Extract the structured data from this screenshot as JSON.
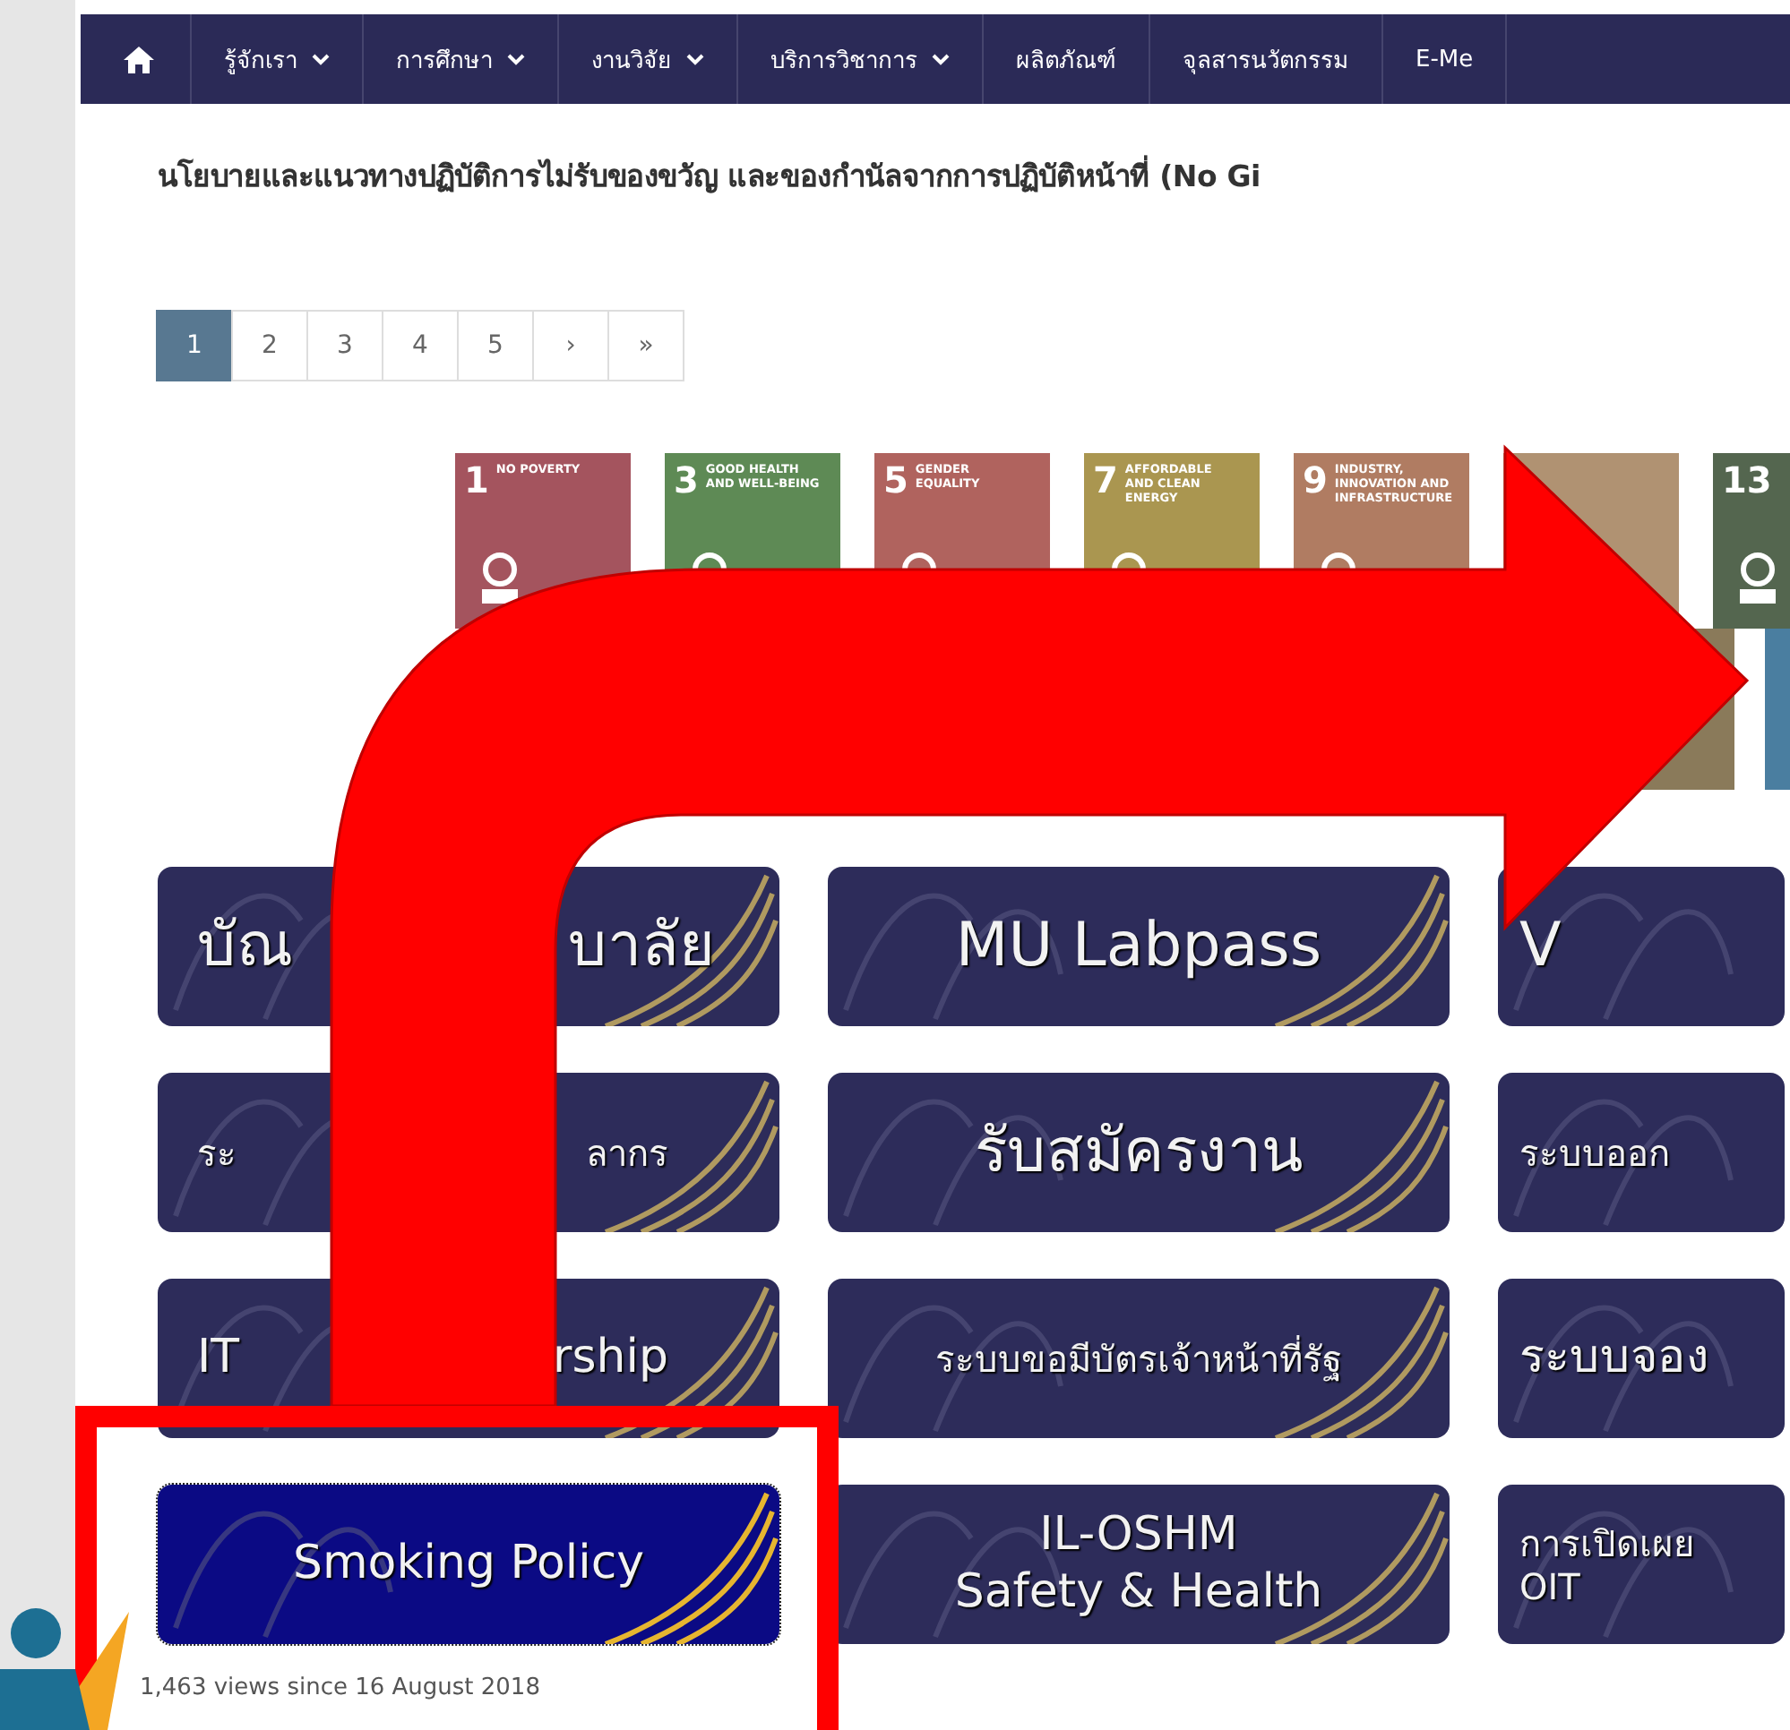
{
  "nav": {
    "items": [
      {
        "kind": "home"
      },
      {
        "kind": "text",
        "label": "รู้จักเรา",
        "has_menu": true
      },
      {
        "kind": "text",
        "label": "การศึกษา",
        "has_menu": true
      },
      {
        "kind": "text",
        "label": "งานวิจัย",
        "has_menu": true
      },
      {
        "kind": "text",
        "label": "บริการวิชาการ",
        "has_menu": true
      },
      {
        "kind": "text",
        "label": "ผลิตภัณฑ์",
        "has_menu": false
      },
      {
        "kind": "text",
        "label": "จุลสารนวัตกรรม",
        "has_menu": false
      },
      {
        "kind": "text",
        "label": "E-Me",
        "has_menu": false
      }
    ]
  },
  "heading": "นโยบายและแนวทางปฏิบัติการไม่รับของขวัญ และของกำนัลจากการปฏิบัติหน้าที่ (No Gi",
  "pagination": [
    {
      "label": "1",
      "selected": true
    },
    {
      "label": "2",
      "selected": false
    },
    {
      "label": "3",
      "selected": false
    },
    {
      "label": "4",
      "selected": false
    },
    {
      "label": "5",
      "selected": false
    },
    {
      "label": "›",
      "selected": false
    },
    {
      "label": "»",
      "selected": false
    }
  ],
  "goal_tiles": [
    [
      {
        "number": "1",
        "title": "NO POVERTY",
        "color": "#a4545e"
      },
      {
        "number": "3",
        "title": "GOOD HEALTH AND WELL-BEING",
        "color": "#5e8a55"
      },
      {
        "number": "5",
        "title": "GENDER EQUALITY",
        "color": "#b0635e"
      },
      {
        "number": "7",
        "title": "AFFORDABLE AND CLEAN ENERGY",
        "color": "#aa9650"
      },
      {
        "number": "9",
        "title": "INDUSTRY, INNOVATION AND INFRASTRUCTURE",
        "color": "#b07c62"
      },
      {
        "color": "#b09272"
      },
      {
        "number": "13",
        "color": "#54664f"
      }
    ],
    [
      {
        "color": "#8a7a5a"
      },
      {
        "color": "#4a7ea0"
      }
    ]
  ],
  "link_buttons": [
    {
      "kind": "large",
      "lines": [
        [
          "บัณ",
          "บาลัย"
        ]
      ],
      "selected": false
    },
    {
      "kind": "large",
      "lines": [
        [
          "MU Labpass"
        ]
      ],
      "selected": false
    },
    {
      "kind": "large",
      "lines": [
        [
          "V"
        ]
      ],
      "selected": false
    },
    {
      "kind": "small",
      "lines": [
        [
          "ระ",
          "ลากร"
        ]
      ],
      "selected": false
    },
    {
      "kind": "large",
      "lines": [
        [
          "รับสมัครงาน"
        ]
      ],
      "selected": false
    },
    {
      "kind": "small",
      "lines": [
        [
          "ระบบออก"
        ]
      ],
      "selected": false
    },
    {
      "kind": "medium",
      "lines": [
        [
          "IT",
          "rship"
        ]
      ],
      "selected": false
    },
    {
      "kind": "small",
      "lines": [
        [
          "ระบบขอมีบัตรเจ้าหน้าที่รัฐ"
        ]
      ],
      "selected": false
    },
    {
      "kind": "medium",
      "lines": [
        [
          "ระบบจอง"
        ]
      ],
      "selected": false
    },
    {
      "kind": "medium",
      "lines": [
        [
          "Smoking Policy"
        ]
      ],
      "selected": true
    },
    {
      "kind": "medium",
      "lines": [
        [
          "IL-OSHM"
        ],
        [
          "Safety & Health"
        ]
      ],
      "selected": false
    },
    {
      "kind": "small",
      "lines": [
        [
          "การเปิดเผย"
        ],
        [
          "OIT"
        ]
      ],
      "selected": false
    }
  ],
  "views_note": "1,463 views since 16 August 2018"
}
